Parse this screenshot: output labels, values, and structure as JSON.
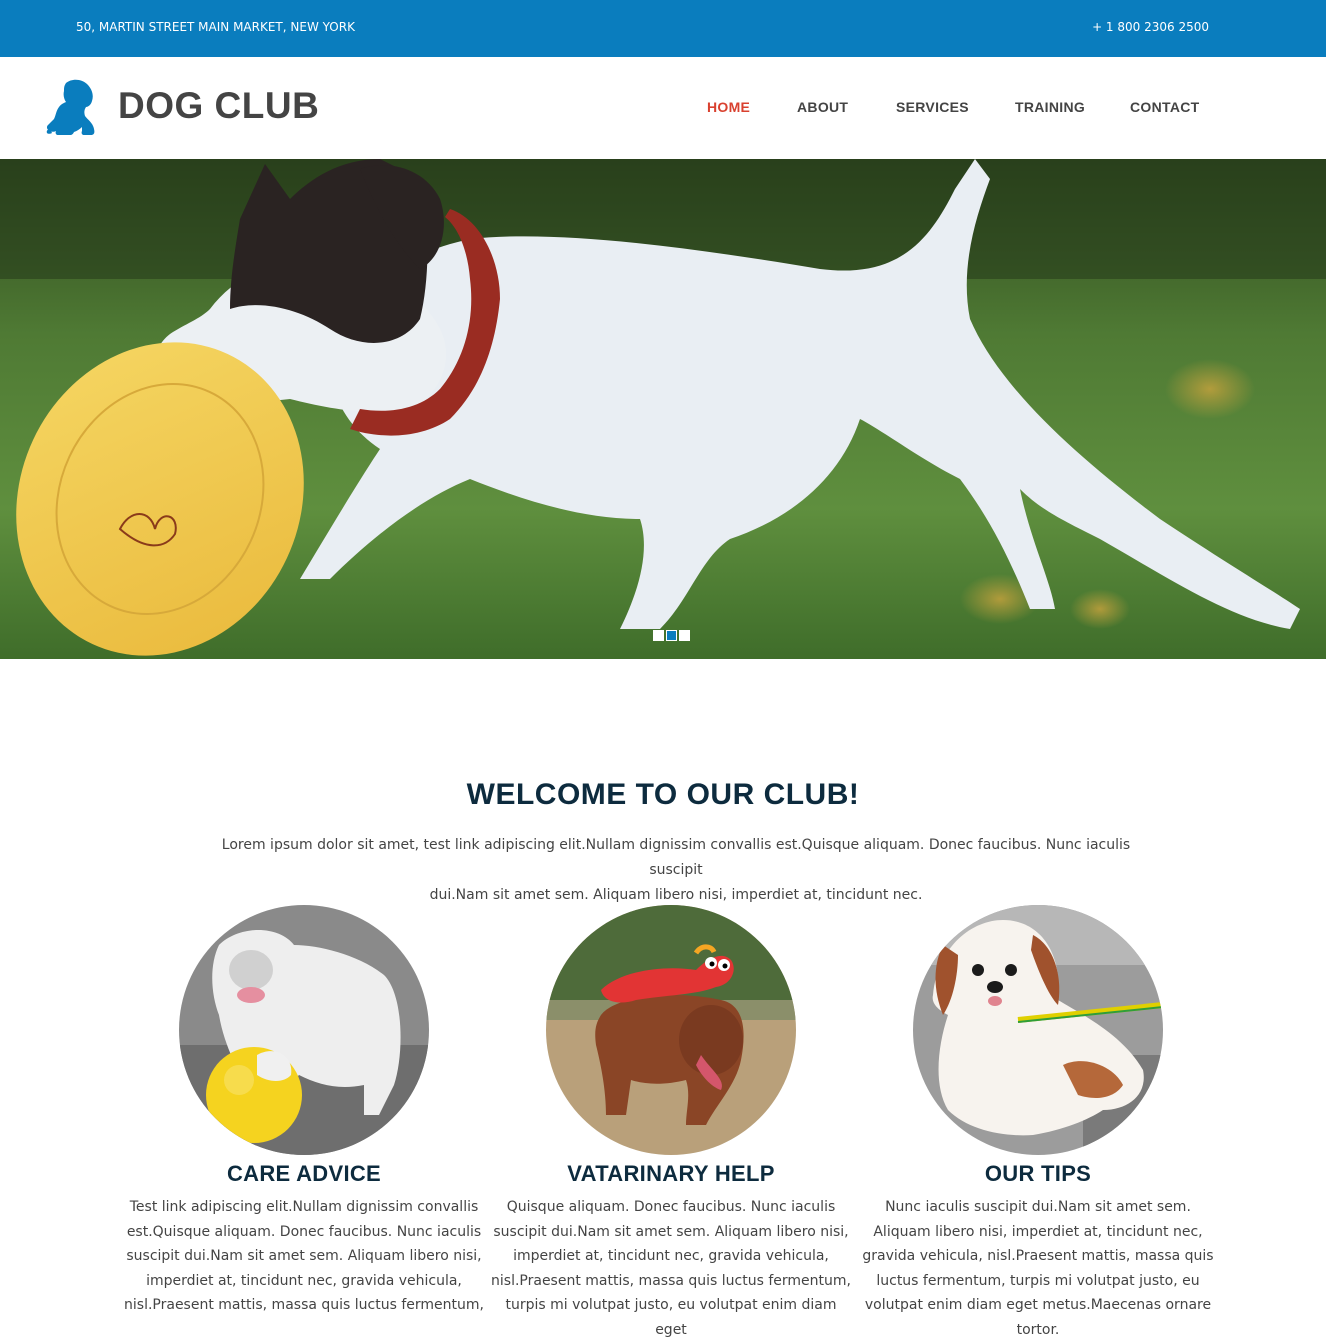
{
  "topbar": {
    "address": "50, MARTIN STREET MAIN MARKET, NEW YORK",
    "phone": "+ 1 800 2306 2500",
    "color": "#0a7dbe"
  },
  "header": {
    "logo_icon": "dog-silhouette-icon",
    "logo_text": "DOG CLUB",
    "nav": [
      {
        "label": "HOME",
        "active": true
      },
      {
        "label": "ABOUT",
        "active": false
      },
      {
        "label": "SERVICES",
        "active": false
      },
      {
        "label": "TRAINING",
        "active": false
      },
      {
        "label": "CONTACT",
        "active": false
      }
    ],
    "active_color": "#d9412f"
  },
  "hero": {
    "slide_count": 3,
    "active_slide": 2
  },
  "welcome": {
    "title": "WELCOME TO OUR CLUB!",
    "text_line1": "Lorem ipsum dolor sit amet, test link adipiscing elit.Nullam dignissim convallis est.Quisque aliquam. Donec faucibus. Nunc iaculis suscipit",
    "text_line2": "dui.Nam sit amet sem. Aliquam libero nisi, imperdiet at, tincidunt nec."
  },
  "features": [
    {
      "title": "CARE ADVICE",
      "text": "Test link adipiscing elit.Nullam dignissim convallis est.Quisque aliquam. Donec faucibus. Nunc iaculis suscipit dui.Nam sit amet sem. Aliquam libero nisi, imperdiet at, tincidunt nec, gravida vehicula, nisl.Praesent mattis, massa quis luctus fermentum,"
    },
    {
      "title": "VATARINARY HELP",
      "text": "Quisque aliquam. Donec faucibus. Nunc iaculis suscipit dui.Nam sit amet sem. Aliquam libero nisi, imperdiet at, tincidunt nec, gravida vehicula, nisl.Praesent mattis, massa quis luctus fermentum, turpis mi volutpat justo, eu volutpat enim diam eget"
    },
    {
      "title": "OUR TIPS",
      "text": "Nunc iaculis suscipit dui.Nam sit amet sem. Aliquam libero nisi, imperdiet at, tincidunt nec, gravida vehicula, nisl.Praesent mattis, massa quis luctus fermentum, turpis mi volutpat justo, eu volutpat enim diam eget metus.Maecenas ornare tortor."
    }
  ]
}
